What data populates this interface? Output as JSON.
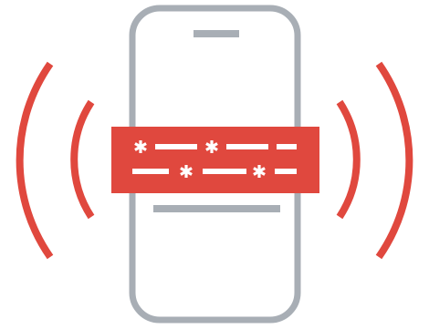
{
  "illustration": {
    "icon_name": "phone-masked-code-broadcast",
    "colors": {
      "accent": "#e0483e",
      "device": "#a8aeb5",
      "background": "#ffffff",
      "mask_symbols": "#ffffff"
    }
  }
}
